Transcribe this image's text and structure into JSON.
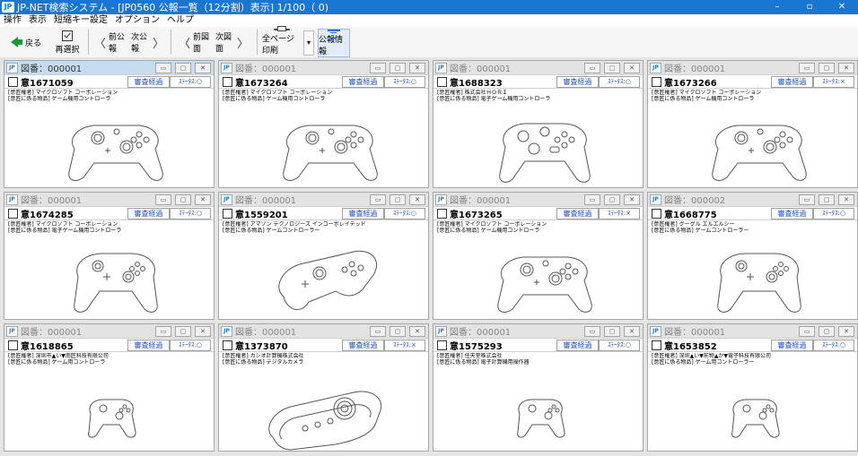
{
  "window": {
    "title": "JP-NET検索システム - [JP0560 公報一覧（12分割）表示]  1/100（ 0)",
    "app_icon_text": "JP",
    "controls": [
      "–",
      "▫",
      "✕"
    ]
  },
  "menu": [
    "操作",
    "表示",
    "短縮キー設定",
    "オプション",
    "ヘルプ"
  ],
  "toolbar": {
    "back": "戻る",
    "select": "再選択",
    "prev_pub": "前公報",
    "next_pub": "次公報",
    "prev_fig": "前図面",
    "next_fig": "次図面",
    "print_all": "全ページ印刷",
    "pub_info": "公報情報",
    "chevron_left": "〈",
    "chevron_right": "〉",
    "dropdown_arrow": "▾"
  },
  "panel_buttons": {
    "review": "審査経過",
    "minimize_glyph": "▭",
    "restore_glyph": "▢",
    "close_glyph": "✕"
  },
  "panels": [
    {
      "title": "図番：000001",
      "number": "意1671059",
      "status": "ｽﾃｰﾀｽ:○",
      "line1": "[意匠権者] マイクロソフト コーポレーション",
      "line2": "[意匠に係る物品] ゲーム機用コントローラ",
      "image": "gamepad-style-a"
    },
    {
      "title": "図番：000001",
      "number": "意1673264",
      "status": "ｽﾃｰﾀｽ:○",
      "line1": "[意匠権者] マイクロソフト コーポレーション",
      "line2": "[意匠に係る物品] ゲーム機用コントローラ",
      "image": "gamepad-style-a"
    },
    {
      "title": "図番：000001",
      "number": "意1688323",
      "status": "ｽﾃｰﾀｽ:○",
      "line1": "[意匠権者] 株式会社ＨＯＲＩ",
      "line2": "[意匠に係る物品] 電子ゲーム機用コントローラ",
      "image": "gamepad-style-b"
    },
    {
      "title": "図番：000001",
      "number": "意1673266",
      "status": "ｽﾃｰﾀｽ:×",
      "line1": "[意匠権者] マイクロソフト コーポレーション",
      "line2": "[意匠に係る物品] ゲーム機用コントローラ",
      "image": "gamepad-style-a"
    },
    {
      "title": "図番：000001",
      "number": "意1674285",
      "status": "ｽﾃｰﾀｽ:○",
      "line1": "[意匠権者] マイクロソフト コーポレーション",
      "line2": "[意匠に係る物品] 電子ゲーム機用コントローラ",
      "image": "gamepad-style-c"
    },
    {
      "title": "図番：000001",
      "number": "意1559201",
      "status": "ｽﾃｰﾀｽ:○",
      "line1": "[意匠権者] アマゾン テクノロジーズ インコーポレイテッド",
      "line2": "[意匠に係る物品] ゲームコントローラー",
      "image": "gamepad-style-d"
    },
    {
      "title": "図番：000001",
      "number": "意1673265",
      "status": "ｽﾃｰﾀｽ:×",
      "line1": "[意匠権者] マイクロソフト コーポレーション",
      "line2": "[意匠に係る物品] ゲーム機用コントローラ",
      "image": "gamepad-style-a"
    },
    {
      "title": "図番：000002",
      "number": "意1668775",
      "status": "ｽﾃｰﾀｽ:○",
      "line1": "[意匠権者] グーグル エルエルシー",
      "line2": "[意匠に係る物品] ゲームコントローラー",
      "image": "gamepad-style-c"
    },
    {
      "title": "図番：000001",
      "number": "意1618865",
      "status": "ｽﾃｰﾀｽ:○",
      "line1": "[意匠権者] 深圳市▲い▼南匠科技有限公司",
      "line2": "[意匠に係る物品] ゲーム用コントローラ",
      "image": "gamepad-style-small"
    },
    {
      "title": "図番：000001",
      "number": "意1373870",
      "status": "ｽﾃｰﾀｽ:×",
      "line1": "[意匠権者] カシオ計算機株式会社",
      "line2": "[意匠に係る物品] デジタルカメラ",
      "image": "camera"
    },
    {
      "title": "図番：000001",
      "number": "意1575293",
      "status": "ｽﾃｰﾀｽ:○",
      "line1": "[意匠権者] 任天堂株式会社",
      "line2": "[意匠に係る物品] 電子計算機用操作器",
      "image": "gamepad-style-small"
    },
    {
      "title": "図番：000001",
      "number": "意1653852",
      "status": "ｽﾃｰﾀｽ:○",
      "line1": "[意匠権者] 深圳▲い▼前物▲か▼電子科技有限公司",
      "line2": "[意匠に係る物品] ゲーム用コントローラー",
      "image": "gamepad-style-small"
    }
  ],
  "colors": {
    "title_bar": "#1976d2",
    "link_blue": "#1e50c8",
    "active_panel_header": "#c8dcf0",
    "back_arrow": "#1a9b3a"
  }
}
